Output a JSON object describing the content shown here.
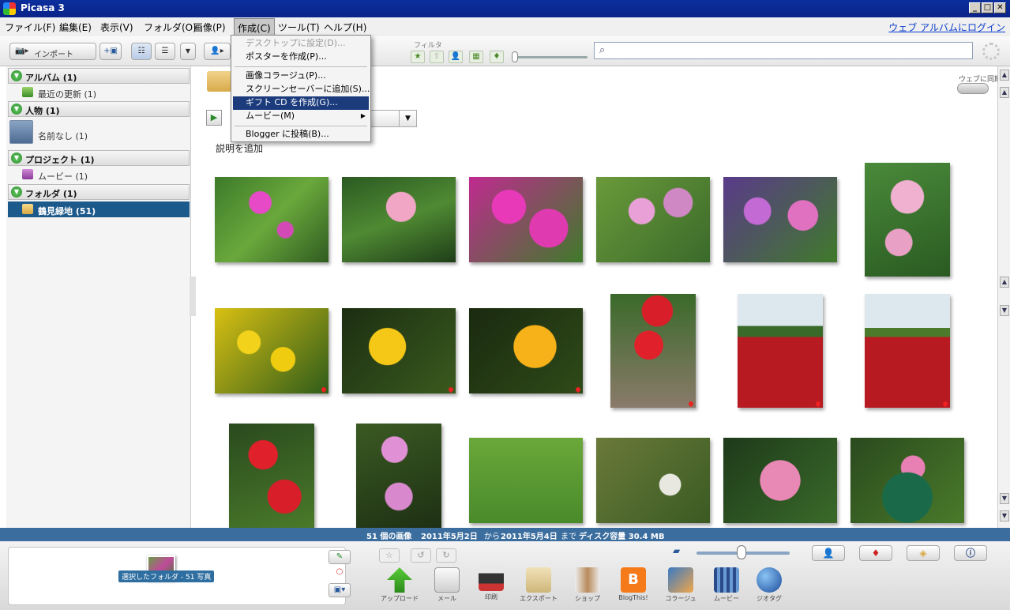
{
  "app": {
    "title": "Picasa 3",
    "window_buttons": [
      "_",
      "□",
      "✕"
    ]
  },
  "menubar": {
    "items": [
      "ファイル(F)",
      "編集(E)",
      "表示(V)",
      "フォルダ(O)",
      "画像(P)",
      "作成(C)",
      "ツール(T)",
      "ヘルプ(H)"
    ],
    "weblogin": "ウェブ アルバムにログイン"
  },
  "toolbar": {
    "import_label": "インポート",
    "filter_label": "フィルタ",
    "search_placeholder": ""
  },
  "create_menu": {
    "items": [
      "デスクトップに設定(D)...",
      "ポスターを作成(P)...",
      "画像コラージュ(P)...",
      "スクリーンセーバーに追加(S)...",
      "ギフト CD を作成(G)...",
      "ムービー(M)",
      "Blogger に投稿(B)..."
    ],
    "highlighted": "ギフト CD を作成(G)..."
  },
  "library": {
    "albums_header": "アルバム (1)",
    "albums_items": [
      "最近の更新 (1)"
    ],
    "people_header": "人物 (1)",
    "people_items": [
      "名前なし (1)"
    ],
    "projects_header": "プロジェクト (1)",
    "projects_items": [
      "ムービー (1)"
    ],
    "folders_header": "フォルダ (1)",
    "folders_items": [
      "鶴見緑地 (51)"
    ],
    "selected": "鶴見緑地 (51)"
  },
  "content": {
    "sync_label": "ウェブに同期",
    "description": "説明を追加",
    "sort_value": ""
  },
  "status": {
    "count": "51 個の画像",
    "from": "2011年5月2日",
    "from_word": "から",
    "to": "2011年5月4日",
    "to_word": "まで",
    "disk": "ディスク容量 30.4 MB"
  },
  "tray": {
    "selected_label": "選択したフォルダ - 51 写真",
    "actions": [
      "アップロード",
      "メール",
      "印刷",
      "エクスポート",
      "ショップ",
      "BlogThis!",
      "コラージュ",
      "ムービー",
      "ジオタグ"
    ]
  },
  "colors": {
    "titlebar": "#0a238a",
    "selection": "#1d5a8c",
    "status": "#3b6e9e",
    "menu_highlight": "#1b3b7d"
  }
}
